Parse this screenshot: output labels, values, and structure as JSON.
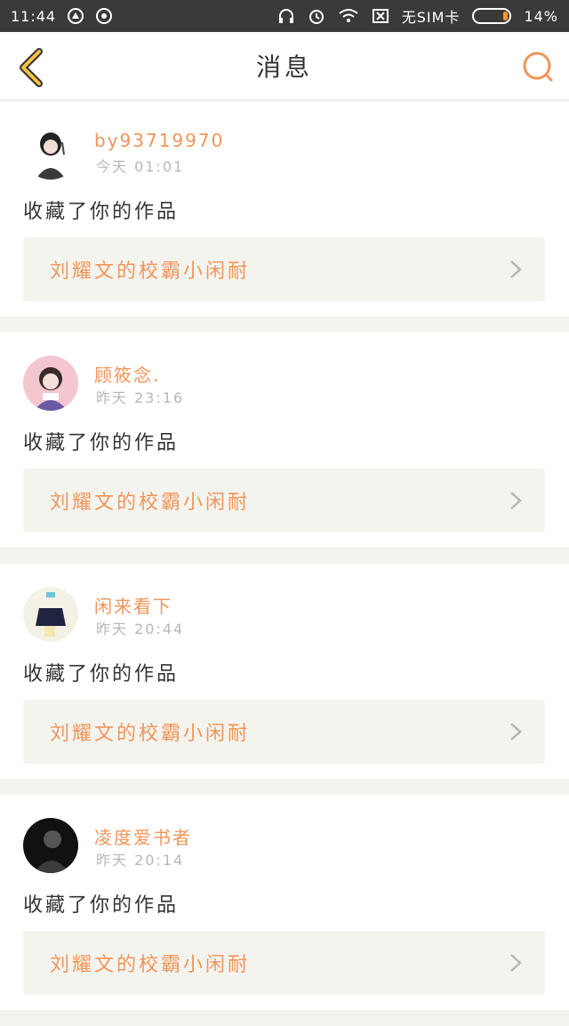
{
  "status_bar": {
    "time": "11:44",
    "carrier": "无SIM卡",
    "battery": "14%",
    "battery_level": 0.14
  },
  "header": {
    "title": "消息",
    "back_icon": "chevron-left-icon",
    "search_icon": "search-icon"
  },
  "colors": {
    "accent": "#f0955a",
    "back": "#f5c33b"
  },
  "messages": [
    {
      "username": "by93719970",
      "time": "今天 01:01",
      "action": "收藏了你的作品",
      "work_title": "刘耀文的校霸小闲耐"
    },
    {
      "username": "顾筱念.",
      "time": "昨天 23:16",
      "action": "收藏了你的作品",
      "work_title": "刘耀文的校霸小闲耐"
    },
    {
      "username": "闲来看下",
      "time": "昨天 20:44",
      "action": "收藏了你的作品",
      "work_title": "刘耀文的校霸小闲耐"
    },
    {
      "username": "凌度爱书者",
      "time": "昨天 20:14",
      "action": "收藏了你的作品",
      "work_title": "刘耀文的校霸小闲耐"
    }
  ]
}
